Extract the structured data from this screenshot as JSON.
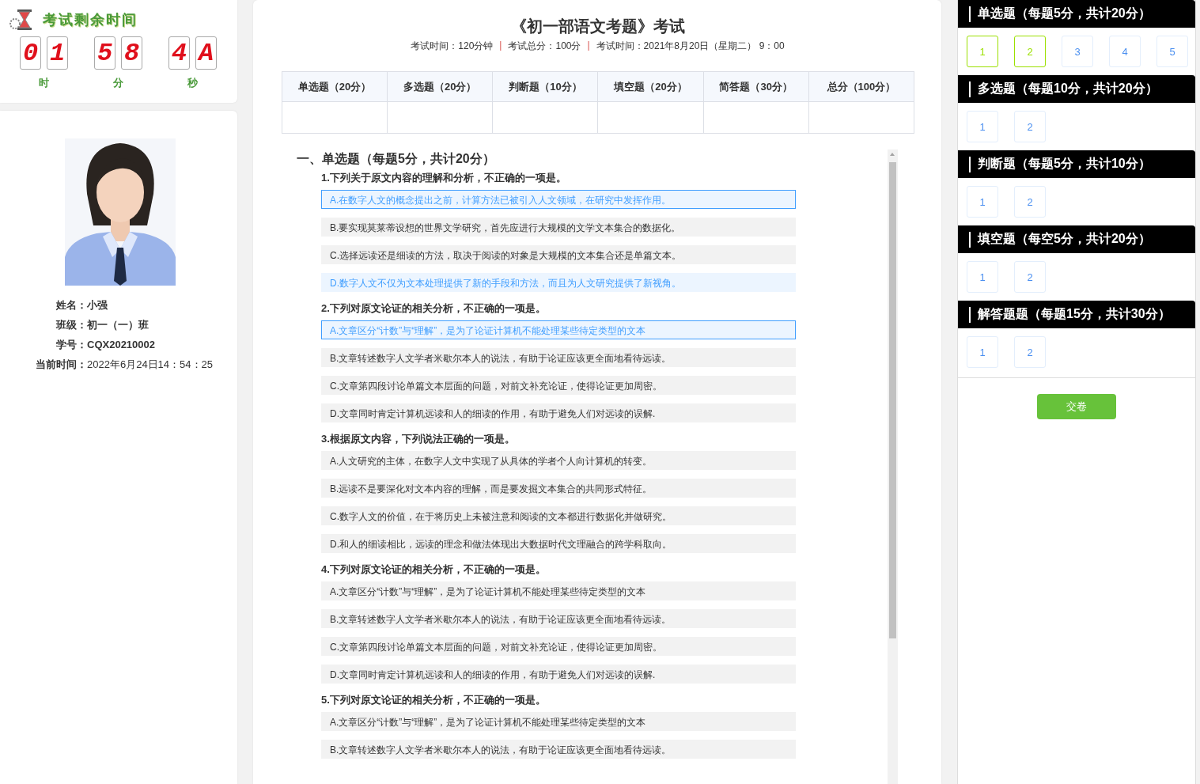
{
  "timer": {
    "title": "考试剩余时间",
    "groups": [
      {
        "digits": [
          "0",
          "1"
        ],
        "unit": "时"
      },
      {
        "digits": [
          "5",
          "8"
        ],
        "unit": "分"
      },
      {
        "digits": [
          "4",
          "A"
        ],
        "unit": "秒"
      }
    ]
  },
  "student": {
    "fields": [
      {
        "label": "姓名：",
        "value": "小强",
        "bold": true
      },
      {
        "label": "班级：",
        "value": "初一（一）班",
        "bold": true
      },
      {
        "label": "学号：",
        "value": "CQX20210002",
        "bold": true
      },
      {
        "label": "当前时间：",
        "value": "2022年6月24日14：54：25",
        "bold": false
      }
    ]
  },
  "exam": {
    "title": "《初一部语文考题》考试",
    "meta": [
      {
        "kind": "text",
        "text": "考试时间：120分钟"
      },
      {
        "kind": "separator",
        "text": "|"
      },
      {
        "kind": "text",
        "text": "考试总分：100分"
      },
      {
        "kind": "separator",
        "text": "|"
      },
      {
        "kind": "text",
        "text": "考试时间：2021年8月20日（星期二） 9：00"
      }
    ],
    "score_table": {
      "columns": [
        "单选题（20分）",
        "多选题（20分）",
        "判断题（10分）",
        "填空题（20分）",
        "简答题（30分）",
        "总分（100分）"
      ]
    },
    "sections": [
      {
        "heading": "一、单选题（每题5分，共计20分）",
        "questions": [
          {
            "text": "1.下列关于原文内容的理解和分析，不正确的一项是。",
            "options": [
              {
                "text": "A.在数字人文的概念提出之前，计算方法已被引入人文领域，在研究中发挥作用。",
                "selected": true,
                "highlighted": false
              },
              {
                "text": "B.要实现莫莱蒂设想的世界文学研究，首先应进行大规模的文学文本集合的数据化。",
                "selected": false,
                "highlighted": false
              },
              {
                "text": "C.选择远读还是细读的方法，取决于阅读的对象是大规模的文本集合还是单篇文本。",
                "selected": false,
                "highlighted": false
              },
              {
                "text": "D.数字人文不仅为文本处理提供了新的手段和方法，而且为人文研究提供了新视角。",
                "selected": false,
                "highlighted": true
              }
            ]
          },
          {
            "text": "2.下列对原文论证的相关分析，不正确的一项是。",
            "options": [
              {
                "text": "A.文章区分“计数”与“理解”，是为了论证计算机不能处理某些待定类型的文本",
                "selected": true,
                "highlighted": false
              },
              {
                "text": "B.文章转述数字人文学者米歇尔本人的说法，有助于论证应该更全面地看待远读。",
                "selected": false,
                "highlighted": false
              },
              {
                "text": "C.文章第四段讨论单篇文本层面的问题，对前文补充论证，使得论证更加周密。",
                "selected": false,
                "highlighted": false
              },
              {
                "text": "D.文章同时肯定计算机远读和人的细读的作用，有助于避免人们对远读的误解.",
                "selected": false,
                "highlighted": false
              }
            ]
          },
          {
            "text": "3.根据原文内容，下列说法正确的一项是。",
            "options": [
              {
                "text": "A.人文研究的主体，在数字人文中实现了从具体的学者个人向计算机的转变。",
                "selected": false,
                "highlighted": false
              },
              {
                "text": "B.远读不是要深化对文本内容的理解，而是要发掘文本集合的共同形式特征。",
                "selected": false,
                "highlighted": false
              },
              {
                "text": "C.数字人文的价值，在于将历史上未被注意和阅读的文本都进行数据化并做研究。",
                "selected": false,
                "highlighted": false
              },
              {
                "text": "D.和人的细读相比，远读的理念和做法体现出大数据时代文理融合的跨学科取向。",
                "selected": false,
                "highlighted": false
              }
            ]
          },
          {
            "text": "4.下列对原文论证的相关分析，不正确的一项是。",
            "options": [
              {
                "text": "A.文章区分“计数”与“理解”，是为了论证计算机不能处理某些待定类型的文本",
                "selected": false,
                "highlighted": false
              },
              {
                "text": "B.文章转述数字人文学者米歇尔本人的说法，有助于论证应该更全面地看待远读。",
                "selected": false,
                "highlighted": false
              },
              {
                "text": "C.文章第四段讨论单篇文本层面的问题，对前文补充论证，使得论证更加周密。",
                "selected": false,
                "highlighted": false
              },
              {
                "text": "D.文章同时肯定计算机远读和人的细读的作用，有助于避免人们对远读的误解.",
                "selected": false,
                "highlighted": false
              }
            ]
          },
          {
            "text": "5.下列对原文论证的相关分析，不正确的一项是。",
            "options": [
              {
                "text": "A.文章区分“计数”与“理解”，是为了论证计算机不能处理某些待定类型的文本",
                "selected": false,
                "highlighted": false
              },
              {
                "text": "B.文章转述数字人文学者米歇尔本人的说法，有助于论证应该更全面地看待远读。",
                "selected": false,
                "highlighted": false
              }
            ]
          }
        ]
      }
    ]
  },
  "answer_sheet": {
    "groups": [
      {
        "title": "单选题（每题5分，共计20分）",
        "items": [
          {
            "label": "1",
            "answered": true
          },
          {
            "label": "2",
            "answered": true
          },
          {
            "label": "3",
            "answered": false
          },
          {
            "label": "4",
            "answered": false
          },
          {
            "label": "5",
            "answered": false
          }
        ]
      },
      {
        "title": "多选题（每题10分，共计20分）",
        "items": [
          {
            "label": "1",
            "answered": false
          },
          {
            "label": "2",
            "answered": false
          }
        ]
      },
      {
        "title": "判断题（每题5分，共计10分）",
        "items": [
          {
            "label": "1",
            "answered": false
          },
          {
            "label": "2",
            "answered": false
          }
        ]
      },
      {
        "title": "填空题（每空5分，共计20分）",
        "items": [
          {
            "label": "1",
            "answered": false
          },
          {
            "label": "2",
            "answered": false
          }
        ]
      },
      {
        "title": "解答题题（每题15分，共计30分）",
        "items": [
          {
            "label": "1",
            "answered": false
          },
          {
            "label": "2",
            "answered": false
          }
        ]
      }
    ],
    "submit": "交卷"
  }
}
